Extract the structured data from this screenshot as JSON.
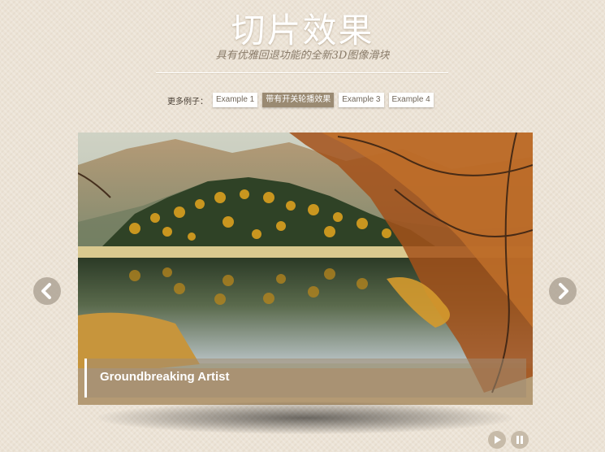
{
  "header": {
    "title": "切片效果",
    "subtitle": "具有优雅回退功能的全新3D图像滑块"
  },
  "nav": {
    "label": "更多例子：",
    "items": [
      {
        "label": "Example 1",
        "active": false
      },
      {
        "label": "带有开关轮播效果",
        "active": true
      },
      {
        "label": "Example 3",
        "active": false
      },
      {
        "label": "Example 4",
        "active": false
      }
    ]
  },
  "slider": {
    "caption": "Groundbreaking Artist",
    "image_description_icon": "autumn-lake-image"
  },
  "icons": {
    "prev": "chevron-left-icon",
    "next": "chevron-right-icon",
    "play": "play-icon",
    "pause": "pause-icon"
  },
  "colors": {
    "background": "#ece3d6",
    "nav_active": "#9a8a72",
    "control": "#c7bba9"
  }
}
